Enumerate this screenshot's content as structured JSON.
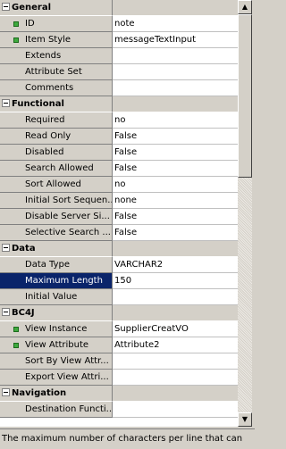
{
  "sections": [
    {
      "title": "General",
      "rows": [
        {
          "label": "ID",
          "value": "note",
          "bullet": true
        },
        {
          "label": "Item Style",
          "value": "messageTextInput",
          "bullet": true
        },
        {
          "label": "Extends",
          "value": ""
        },
        {
          "label": "Attribute Set",
          "value": ""
        },
        {
          "label": "Comments",
          "value": ""
        }
      ]
    },
    {
      "title": "Functional",
      "rows": [
        {
          "label": "Required",
          "value": "no"
        },
        {
          "label": "Read Only",
          "value": "False"
        },
        {
          "label": "Disabled",
          "value": "False"
        },
        {
          "label": "Search Allowed",
          "value": "False"
        },
        {
          "label": "Sort Allowed",
          "value": "no"
        },
        {
          "label": "Initial Sort Sequen...",
          "value": "none"
        },
        {
          "label": "Disable Server Si...",
          "value": "False"
        },
        {
          "label": "Selective Search ...",
          "value": "False"
        }
      ]
    },
    {
      "title": "Data",
      "rows": [
        {
          "label": "Data Type",
          "value": "VARCHAR2"
        },
        {
          "label": "Maximum Length",
          "value": "150",
          "selected": true
        },
        {
          "label": "Initial Value",
          "value": ""
        }
      ]
    },
    {
      "title": "BC4J",
      "rows": [
        {
          "label": "View Instance",
          "value": "SupplierCreatVO",
          "bullet": true
        },
        {
          "label": "View Attribute",
          "value": "Attribute2",
          "bullet": true
        },
        {
          "label": "Sort By View Attr...",
          "value": ""
        },
        {
          "label": "Export View Attri...",
          "value": ""
        }
      ]
    },
    {
      "title": "Navigation",
      "rows": [
        {
          "label": "Destination Functi...",
          "value": ""
        }
      ]
    }
  ],
  "scrollbar": {
    "up_glyph": "▲",
    "down_glyph": "▼"
  },
  "description": "The maximum number of characters per line that can",
  "colors": {
    "selection": "#0a246a",
    "bullet": "#3faa3f",
    "panel": "#d4d0c8"
  }
}
